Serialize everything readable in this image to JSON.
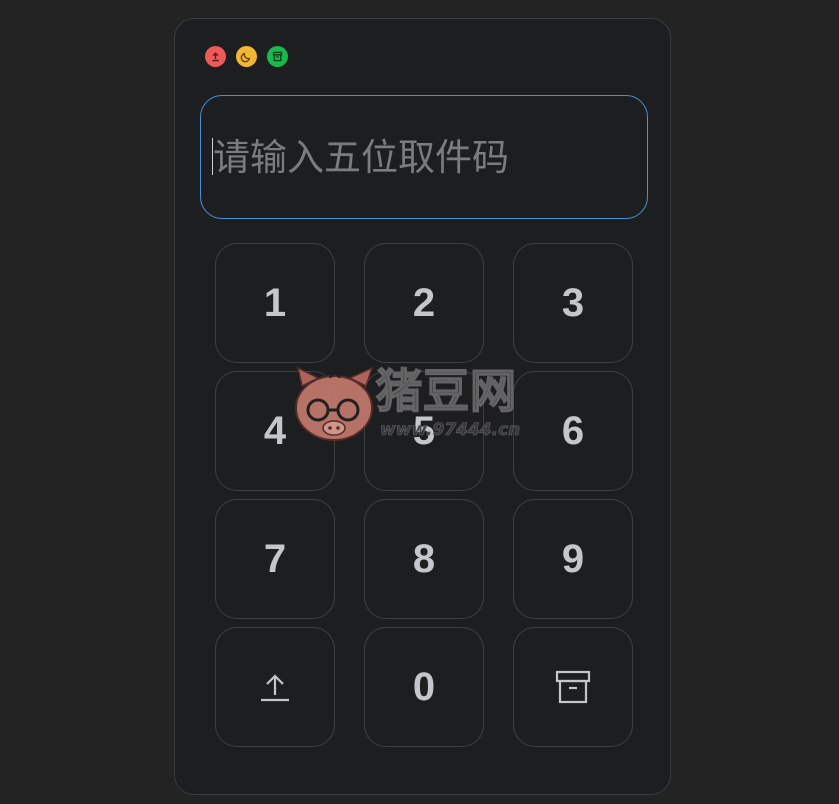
{
  "window": {
    "controls": [
      {
        "name": "upload-dot",
        "color": "#ee5a5a",
        "icon": "upload-icon"
      },
      {
        "name": "moon-dot",
        "color": "#f2b634",
        "icon": "moon-icon"
      },
      {
        "name": "archive-dot",
        "color": "#19b94b",
        "icon": "archive-icon"
      }
    ]
  },
  "input": {
    "value": "",
    "placeholder": "请输入五位取件码",
    "border_color": "#4a8fd8"
  },
  "keypad": {
    "keys": [
      "1",
      "2",
      "3",
      "4",
      "5",
      "6",
      "7",
      "8",
      "9",
      "",
      "0",
      ""
    ],
    "upload_icon": "upload-icon",
    "archive_icon": "archive-icon"
  },
  "watermark": {
    "brand": "猪豆网",
    "url": "www.97444.cn"
  }
}
